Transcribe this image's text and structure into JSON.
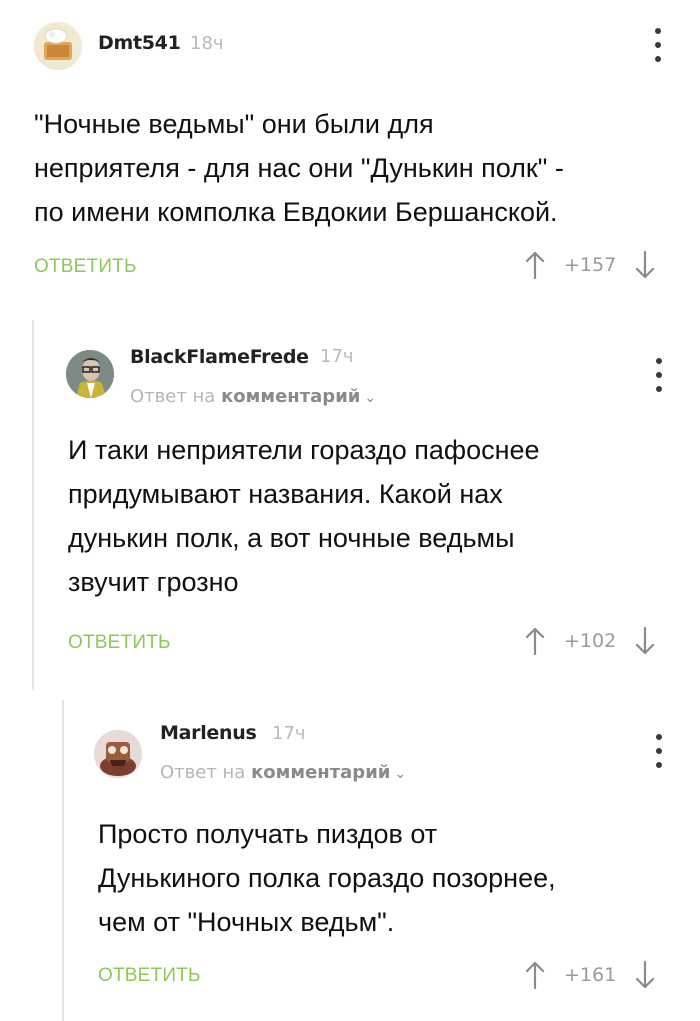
{
  "comments": [
    {
      "username": "Dmt541",
      "time": "18ч",
      "text": "\"Ночные ведьмы\" они были для\nнеприятеля - для нас они \"Дунькин полк\" -\nпо имени комполка  Евдокии Бершанской.",
      "reply_label": "ОТВЕТИТЬ",
      "rating": "+157"
    },
    {
      "username": "BlackFlameFrede",
      "time": "17ч",
      "reply_to_prefix": "Ответ на",
      "reply_to_link": "комментарий",
      "text": "И таки неприятели гораздо пафоснее\nпридумывают названия. Какой нах\nдунькин полк, а вот ночные ведьмы\nзвучит грозно",
      "reply_label": "ОТВЕТИТЬ",
      "rating": "+102"
    },
    {
      "username": "Marlenus",
      "time": "17ч",
      "reply_to_prefix": "Ответ на",
      "reply_to_link": "комментарий",
      "text": "Просто получать пиздов от\nДунькиного полка гораздо позорнее,\nчем от \"Ночных ведьм\".",
      "reply_label": "ОТВЕТИТЬ",
      "rating": "+161"
    }
  ],
  "icons": {
    "menu": "more-vertical-icon",
    "upvote": "arrow-up-icon",
    "downvote": "arrow-down-icon",
    "expand": "chevron-down-icon"
  },
  "colors": {
    "reply_button": "#8ac858",
    "thread_line": "#e4e4e4",
    "muted_text": "#b5b5b5"
  }
}
